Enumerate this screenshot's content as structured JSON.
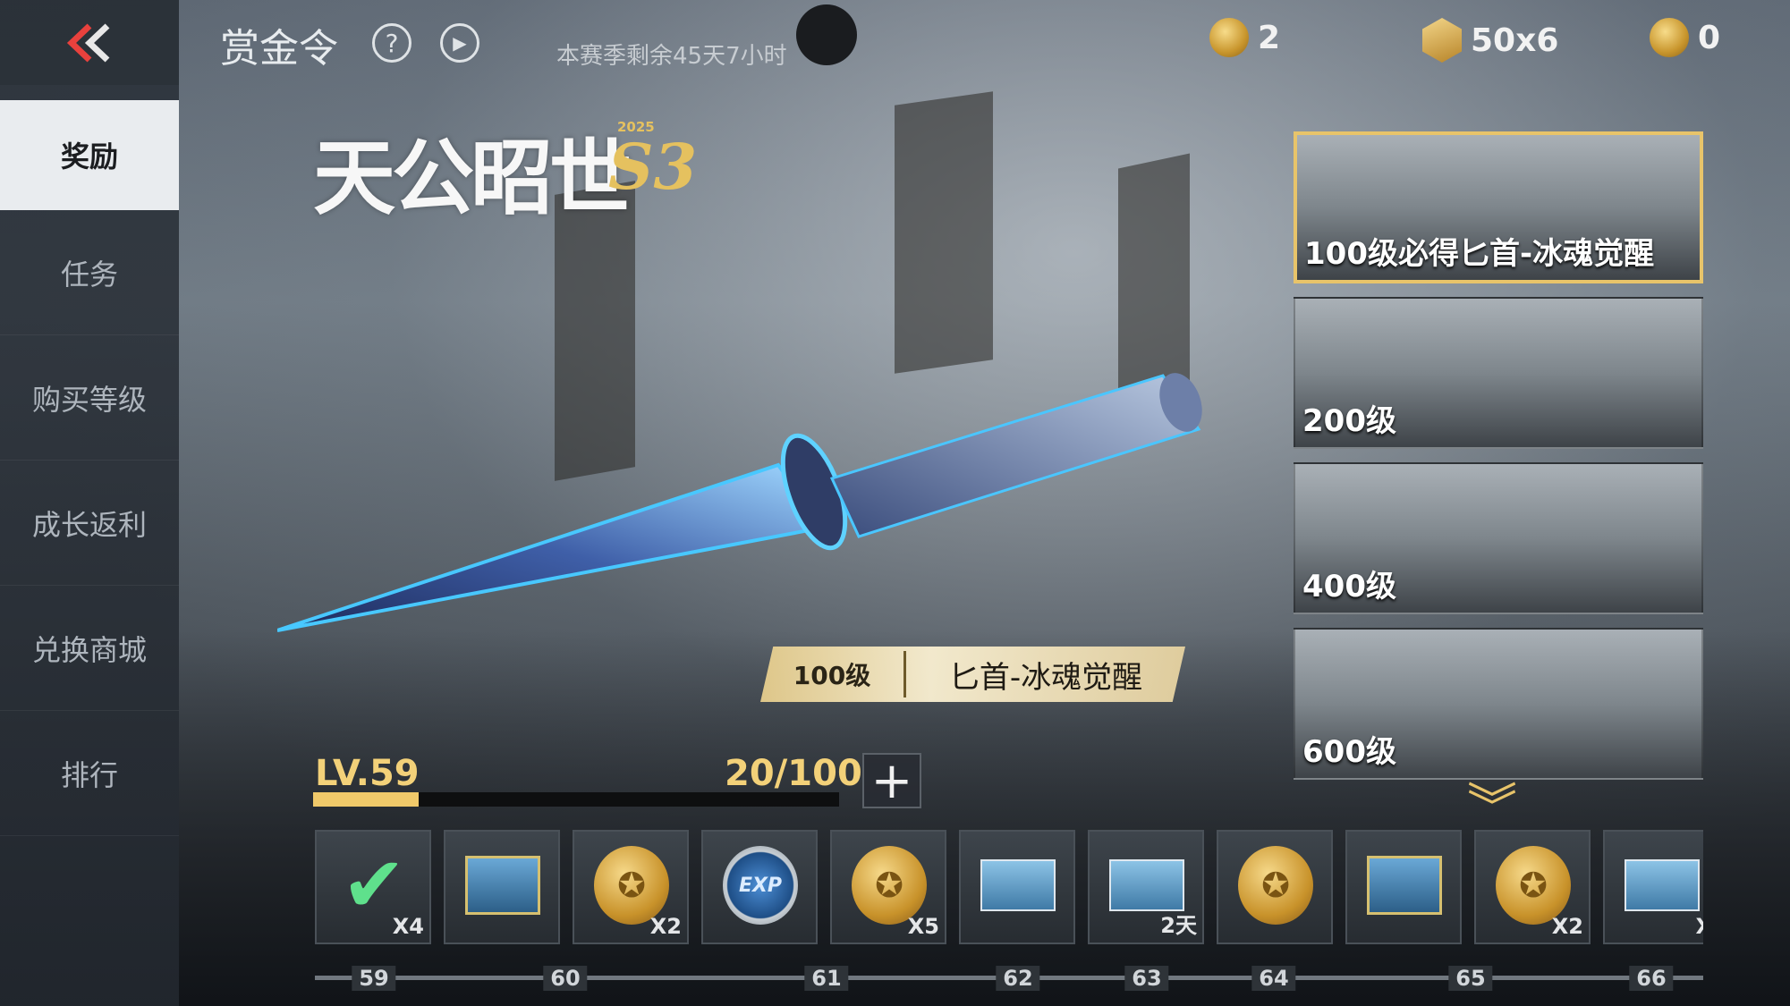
{
  "header": {
    "title": "赏金令",
    "season_text": "本赛季剩余45天7小时",
    "currencies": [
      {
        "icon": "coin-icon",
        "value": "2"
      },
      {
        "icon": "badge-icon",
        "value": "50x6"
      },
      {
        "icon": "ticket-icon",
        "value": "0"
      }
    ]
  },
  "sidebar": {
    "items": [
      {
        "label": "奖励",
        "active": true
      },
      {
        "label": "任务"
      },
      {
        "label": "购买等级"
      },
      {
        "label": "成长返利"
      },
      {
        "label": "兑换商城"
      },
      {
        "label": "排行"
      }
    ]
  },
  "logo": {
    "text": "天公昭世",
    "season": "S3",
    "year": "2025"
  },
  "featured": {
    "level": "100级",
    "name": "匕首-冰魂觉醒"
  },
  "progress": {
    "level_label": "LV.59",
    "count": "20/100",
    "fraction": 0.2
  },
  "side_rewards": [
    {
      "label": "100级必得匕首-冰魂觉醒",
      "selected": true
    },
    {
      "label": "200级"
    },
    {
      "label": "400级"
    },
    {
      "label": "600级"
    }
  ],
  "slots": [
    {
      "type": "claimed",
      "qty": "X4"
    },
    {
      "type": "crate",
      "qty": ""
    },
    {
      "type": "coin",
      "qty": "X2"
    },
    {
      "type": "exp",
      "qty": ""
    },
    {
      "type": "coin",
      "qty": "X5"
    },
    {
      "type": "card",
      "qty": ""
    },
    {
      "type": "card",
      "qty": "2天"
    },
    {
      "type": "coin",
      "qty": ""
    },
    {
      "type": "crate",
      "qty": ""
    },
    {
      "type": "coin",
      "qty": "X2"
    },
    {
      "type": "partial",
      "qty": "X"
    }
  ],
  "level_markers": [
    "59",
    "60",
    "61",
    "62",
    "63",
    "64",
    "65",
    "66"
  ],
  "colors": {
    "accent_gold": "#e8c46a",
    "progress_fill": "#f0c96a",
    "active_tab_bg": "#e9ecef"
  }
}
